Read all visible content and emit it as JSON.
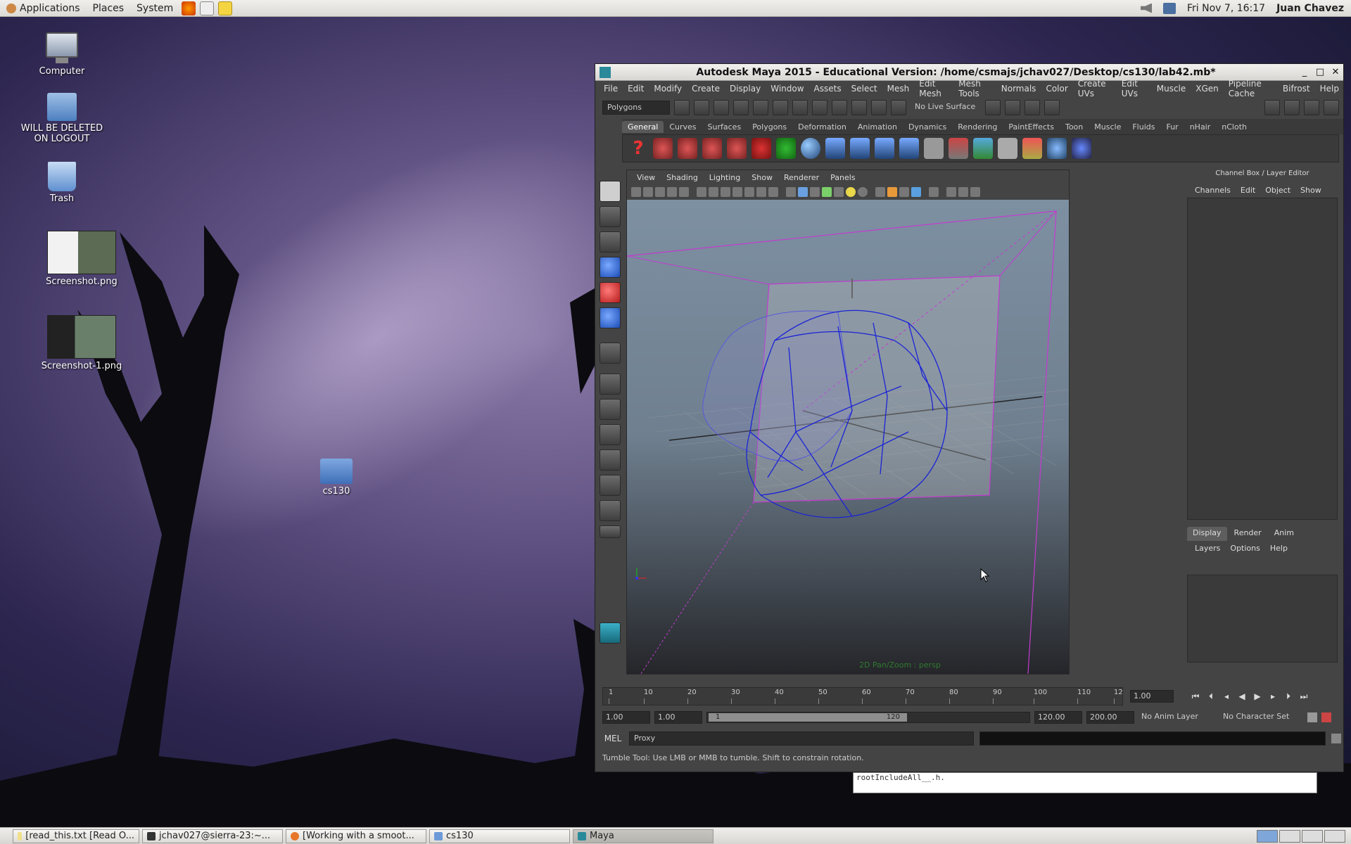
{
  "top_panel": {
    "menus": [
      "Applications",
      "Places",
      "System"
    ],
    "clock": "Fri Nov  7, 16:17",
    "user": "Juan Chavez"
  },
  "desktop": {
    "icons": [
      {
        "label": "Computer"
      },
      {
        "label": "WILL BE DELETED ON LOGOUT"
      },
      {
        "label": "Trash"
      },
      {
        "label": "Screenshot.png"
      },
      {
        "label": "Screenshot-1.png"
      },
      {
        "label": "cs130"
      }
    ]
  },
  "maya": {
    "title": "Autodesk Maya 2015 - Educational Version: /home/csmajs/jchav027/Desktop/cs130/lab42.mb*",
    "menus": [
      "File",
      "Edit",
      "Modify",
      "Create",
      "Display",
      "Window",
      "Assets",
      "Select",
      "Mesh",
      "Edit Mesh",
      "Mesh Tools",
      "Normals",
      "Color",
      "Create UVs",
      "Edit UVs",
      "Muscle",
      "XGen",
      "Pipeline Cache",
      "Bifrost",
      "Help"
    ],
    "status_line": {
      "mode": "Polygons",
      "live_surface": "No Live Surface"
    },
    "shelf_tabs": [
      "General",
      "Curves",
      "Surfaces",
      "Polygons",
      "Deformation",
      "Animation",
      "Dynamics",
      "Rendering",
      "PaintEffects",
      "Toon",
      "Muscle",
      "Fluids",
      "Fur",
      "nHair",
      "nCloth"
    ],
    "active_shelf": "General",
    "viewport": {
      "menus": [
        "View",
        "Shading",
        "Lighting",
        "Show",
        "Renderer",
        "Panels"
      ],
      "hud": "2D Pan/Zoom : persp"
    },
    "channel_box": {
      "title": "Channel Box / Layer Editor",
      "menus": [
        "Channels",
        "Edit",
        "Object",
        "Show"
      ],
      "layer_tabs": [
        "Display",
        "Render",
        "Anim"
      ],
      "layer_menus": [
        "Layers",
        "Options",
        "Help"
      ]
    },
    "timeline": {
      "ticks": [
        "1",
        "10",
        "20",
        "30",
        "40",
        "50",
        "60",
        "70",
        "80",
        "90",
        "100",
        "110",
        "12"
      ],
      "current_frame": "1.00",
      "range_start": "1.00",
      "playback_start": "1.00",
      "range_thumb_start": "1",
      "range_thumb_end": "120",
      "playback_end": "120.00",
      "range_end": "200.00",
      "anim_layer": "No Anim Layer",
      "character_set": "No Character Set"
    },
    "command_line": {
      "label": "MEL",
      "value": "Proxy"
    },
    "help_line": "Tumble Tool: Use LMB or MMB to tumble. Shift to constrain rotation."
  },
  "terminal_snippet": "rootIncludeAll__.h.",
  "taskbar": {
    "tasks": [
      {
        "label": "[read_this.txt [Read O..."
      },
      {
        "label": "jchav027@sierra-23:~..."
      },
      {
        "label": "[Working with a smoot..."
      },
      {
        "label": "cs130"
      },
      {
        "label": "Maya"
      }
    ]
  }
}
